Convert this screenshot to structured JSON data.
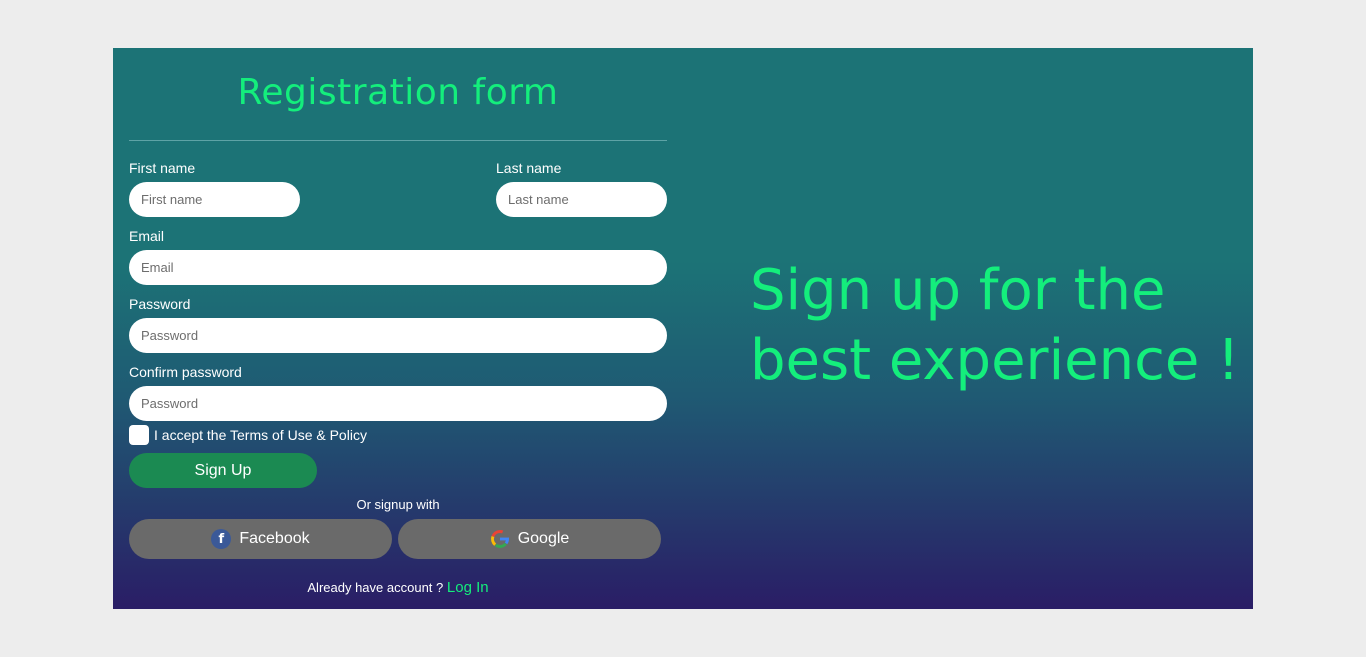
{
  "form": {
    "title": "Registration form",
    "first_name": {
      "label": "First name",
      "placeholder": "First name"
    },
    "last_name": {
      "label": "Last name",
      "placeholder": "Last name"
    },
    "email": {
      "label": "Email",
      "placeholder": "Email"
    },
    "password": {
      "label": "Password",
      "placeholder": "Password"
    },
    "confirm_password": {
      "label": "Confirm password",
      "placeholder": "Password"
    },
    "terms": {
      "label": "I accept the Terms of Use & Policy",
      "checked": false
    },
    "signup_button": "Sign Up",
    "or_text": "Or signup with",
    "social": {
      "facebook": {
        "label": "Facebook",
        "icon": "facebook-icon"
      },
      "google": {
        "label": "Google",
        "icon": "google-icon"
      }
    },
    "footer": {
      "text": "Already have account ?",
      "login_link": "Log In"
    }
  },
  "hero": {
    "line1": "Sign up for the",
    "line2": "best experience !"
  },
  "colors": {
    "accent": "#14ee7c",
    "signup_button": "#1b8a52",
    "social_button": "#6a6a6a",
    "background": "#ededed",
    "gradient_top": "#1c7376",
    "gradient_bottom": "#2a1d66"
  }
}
